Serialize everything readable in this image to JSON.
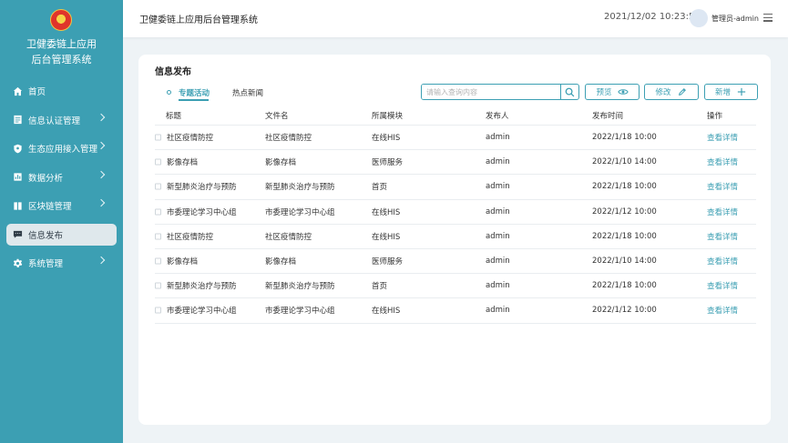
{
  "sidebar": {
    "app_title_line1": "卫健委链上应用",
    "app_title_line2": "后台管理系统",
    "items": [
      {
        "label": "首页",
        "icon": "home-icon"
      },
      {
        "label": "信息认证管理",
        "icon": "id-card-icon"
      },
      {
        "label": "生态应用接入管理",
        "icon": "shield-icon"
      },
      {
        "label": "数据分析",
        "icon": "chart-icon"
      },
      {
        "label": "区块链管理",
        "icon": "book-icon"
      },
      {
        "label": "信息发布",
        "icon": "message-icon"
      },
      {
        "label": "系统管理",
        "icon": "gear-icon"
      }
    ],
    "active_index": 5,
    "accent_color": "#3c9fb3"
  },
  "header": {
    "title": "卫健委链上应用后台管理系统",
    "datetime": "2021/12/02 10:23:57",
    "user": "管理员-admin"
  },
  "main": {
    "card_title": "信息发布",
    "tabs": [
      {
        "label": "专题活动",
        "active": true
      },
      {
        "label": "热点新闻",
        "active": false
      }
    ],
    "search": {
      "placeholder": "请输入查询内容"
    },
    "buttons": {
      "preview": "预览",
      "edit": "修改",
      "add": "新增"
    },
    "table": {
      "columns": [
        "标题",
        "文件名",
        "所属模块",
        "发布人",
        "发布时间",
        "操作"
      ],
      "rows": [
        {
          "title": "社区疫情防控",
          "file": "社区疫情防控",
          "module": "在线HIS",
          "publisher": "admin",
          "time": "2022/1/18 10:00",
          "action": "查看详情"
        },
        {
          "title": "影像存档",
          "file": "影像存档",
          "module": "医师服务",
          "publisher": "admin",
          "time": "2022/1/10 14:00",
          "action": "查看详情"
        },
        {
          "title": "新型肺炎治疗与预防",
          "file": "新型肺炎治疗与预防",
          "module": "首页",
          "publisher": "admin",
          "time": "2022/1/18 10:00",
          "action": "查看详情"
        },
        {
          "title": "市委理论学习中心组",
          "file": "市委理论学习中心组",
          "module": "在线HIS",
          "publisher": "admin",
          "time": "2022/1/12 10:00",
          "action": "查看详情"
        },
        {
          "title": "社区疫情防控",
          "file": "社区疫情防控",
          "module": "在线HIS",
          "publisher": "admin",
          "time": "2022/1/18 10:00",
          "action": "查看详情"
        },
        {
          "title": "影像存档",
          "file": "影像存档",
          "module": "医师服务",
          "publisher": "admin",
          "time": "2022/1/10 14:00",
          "action": "查看详情"
        },
        {
          "title": "新型肺炎治疗与预防",
          "file": "新型肺炎治疗与预防",
          "module": "首页",
          "publisher": "admin",
          "time": "2022/1/18 10:00",
          "action": "查看详情"
        },
        {
          "title": "市委理论学习中心组",
          "file": "市委理论学习中心组",
          "module": "在线HIS",
          "publisher": "admin",
          "time": "2022/1/12 10:00",
          "action": "查看详情"
        }
      ]
    }
  }
}
